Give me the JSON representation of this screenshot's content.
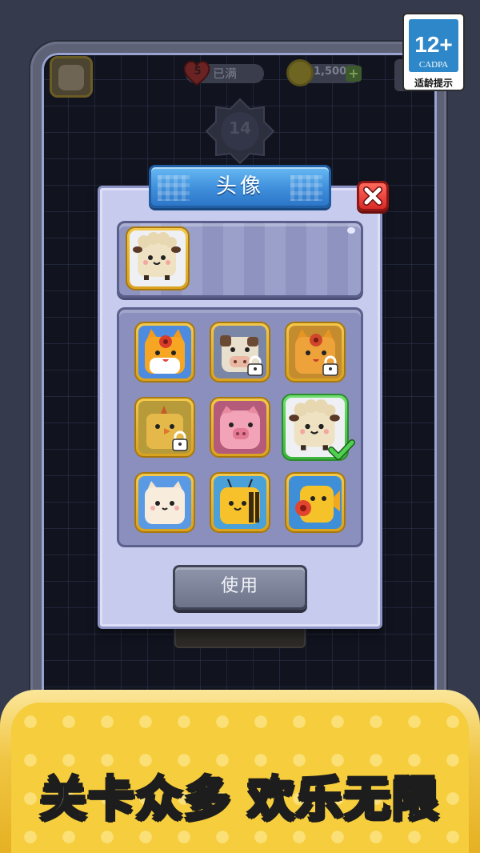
{
  "rating": {
    "age": "12+",
    "org": "CADPA",
    "note": "适龄提示"
  },
  "hud": {
    "lives": "5",
    "lives_status": "已满",
    "coins": "1,500",
    "coin_plus": "+",
    "level": "14"
  },
  "dialog": {
    "title": "头像",
    "use_button": "使用",
    "avatars": [
      {
        "name": "orange-cat",
        "locked": false,
        "selected": false
      },
      {
        "name": "cow",
        "locked": true,
        "selected": false
      },
      {
        "name": "orange-cat-flower",
        "locked": true,
        "selected": false
      },
      {
        "name": "chick",
        "locked": true,
        "selected": false
      },
      {
        "name": "pig",
        "locked": false,
        "selected": false
      },
      {
        "name": "sheep",
        "locked": false,
        "selected": true
      },
      {
        "name": "white-cat",
        "locked": false,
        "selected": false
      },
      {
        "name": "bee",
        "locked": false,
        "selected": false
      },
      {
        "name": "yellow-fish",
        "locked": false,
        "selected": false
      }
    ]
  },
  "banner": {
    "slogan_left": "关卡众多",
    "slogan_right": "欢乐无限"
  },
  "colors": {
    "accent_blue": "#3f8fdc",
    "close_red": "#d92a27",
    "selected_green": "#3cb43c",
    "banner_gold": "#f6cd3c"
  }
}
